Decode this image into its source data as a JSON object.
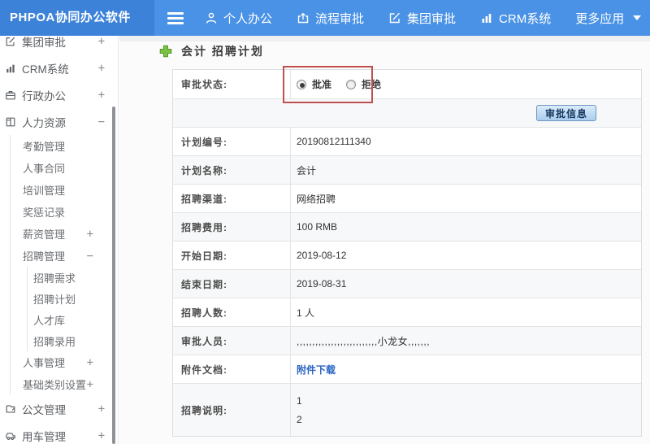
{
  "navbar": {
    "brand": "PHPOA协同办公软件",
    "items": [
      {
        "label": "个人办公",
        "icon": "person-icon"
      },
      {
        "label": "流程审批",
        "icon": "flow-icon"
      },
      {
        "label": "集团审批",
        "icon": "edit-icon"
      },
      {
        "label": "CRM系统",
        "icon": "bar-chart-icon"
      },
      {
        "label": "更多应用",
        "icon": "caret-down-icon"
      }
    ]
  },
  "sidebar": {
    "items": [
      {
        "label": "集团审批",
        "expander": "+",
        "icon": "edit-square-icon"
      },
      {
        "label": "CRM系统",
        "expander": "+",
        "icon": "bar-chart-icon"
      },
      {
        "label": "行政办公",
        "expander": "+",
        "icon": "briefcase-icon"
      },
      {
        "label": "人力资源",
        "expander": "−",
        "icon": "book-icon"
      },
      {
        "label": "考勤管理"
      },
      {
        "label": "人事合同"
      },
      {
        "label": "培训管理"
      },
      {
        "label": "奖惩记录"
      },
      {
        "label": "薪资管理",
        "expander": "+"
      },
      {
        "label": "招聘管理",
        "expander": "−"
      },
      {
        "label": "招聘需求"
      },
      {
        "label": "招聘计划"
      },
      {
        "label": "人才库"
      },
      {
        "label": "招聘录用"
      },
      {
        "label": "人事管理",
        "expander": "+"
      },
      {
        "label": "基础类别设置",
        "expander": "+"
      },
      {
        "label": "公文管理",
        "expander": "+",
        "icon": "document-icon"
      },
      {
        "label": "用车管理",
        "expander": "+",
        "icon": "car-icon"
      }
    ]
  },
  "main": {
    "title": "会计 招聘计划",
    "status_label": "审批状态:",
    "radio_approve": "批准",
    "radio_reject": "拒绝",
    "approve_info_button": "审批信息",
    "fields": [
      {
        "label": "计划编号:",
        "value": "20190812111340"
      },
      {
        "label": "计划名称:",
        "value": "会计"
      },
      {
        "label": "招聘渠道:",
        "value": "网络招聘"
      },
      {
        "label": "招聘费用:",
        "value": "100 RMB"
      },
      {
        "label": "开始日期:",
        "value": "2019-08-12"
      },
      {
        "label": "结束日期:",
        "value": "2019-08-31"
      },
      {
        "label": "招聘人数:",
        "value": "1 人"
      },
      {
        "label": "审批人员:",
        "value": ",,,,,,,,,,,,,,,,,,,,,,,,,,小龙女,,,,,,,"
      },
      {
        "label": "附件文档:",
        "value": "附件下载"
      },
      {
        "label": "招聘说明:",
        "lines": [
          "1",
          "2"
        ]
      }
    ]
  },
  "colors": {
    "navbar_blue": "#4a92e5",
    "brand_blue": "#3d82d9",
    "annotation_red": "#c0504d",
    "link_blue": "#2a64c4",
    "button_face": "#a9cdee",
    "plus_green": "#7bc143"
  }
}
